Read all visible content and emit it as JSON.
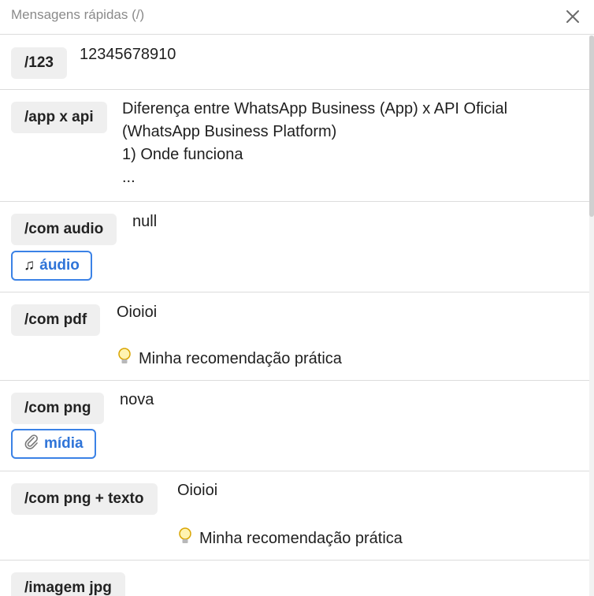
{
  "header": {
    "title": "Mensagens rápidas (/)",
    "close_icon": "close-icon"
  },
  "items": [
    {
      "shortcut": "/123",
      "text": "12345678910"
    },
    {
      "shortcut": "/app x api",
      "text": "Diferença entre WhatsApp Business (App) x API Oficial\n(WhatsApp Business Platform)\n1) Onde funciona\n..."
    },
    {
      "shortcut": "/com audio",
      "text": "null",
      "tag": {
        "icon": "music-note-icon",
        "label": "áudio"
      }
    },
    {
      "shortcut": "/com pdf",
      "text": "Oioioi",
      "hint": {
        "icon": "lightbulb-icon",
        "label": "Minha recomendação prática"
      }
    },
    {
      "shortcut": "/com png",
      "text": "nova",
      "tag": {
        "icon": "paperclip-icon",
        "label": "mídia"
      }
    },
    {
      "shortcut": "/com png + texto",
      "text": "Oioioi",
      "hint": {
        "icon": "lightbulb-icon",
        "label": "Minha recomendação prática"
      }
    },
    {
      "shortcut": "/imagem jpg"
    }
  ],
  "colors": {
    "accent": "#3b82e6",
    "chip_bg": "#efefef",
    "divider": "#dcdcdc"
  }
}
